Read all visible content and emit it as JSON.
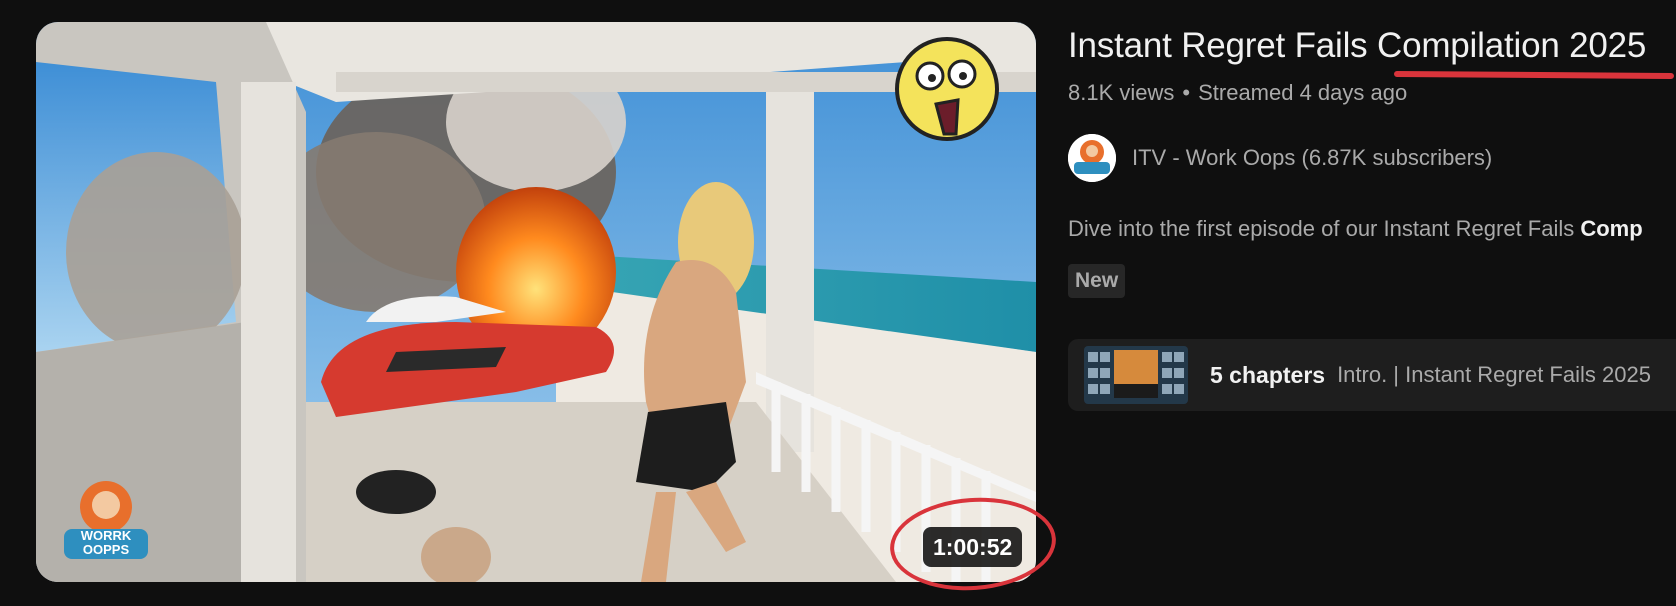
{
  "video": {
    "title": "Instant Regret Fails Compilation 2025",
    "views": "8.1K views",
    "separator": "•",
    "streamed": "Streamed 4 days ago",
    "duration": "1:00:52",
    "thumbnail_icon": "shocked-emoji-icon",
    "thumbnail_logo_text": "WORRK OOPPS"
  },
  "channel": {
    "name": "ITV - Work Oops (6.87K subscribers)",
    "avatar_icon": "channel-avatar-icon"
  },
  "description": {
    "text": "Dive into the first episode of our Instant Regret Fails ",
    "bold": "Comp"
  },
  "badge": {
    "label": "New"
  },
  "chapters": {
    "count_label": "5 chapters",
    "title": "Intro. | Instant Regret Fails 2025"
  },
  "colors": {
    "background": "#0f0f0f",
    "annotation_red": "#d9343b",
    "secondary_text": "#aaaaaa",
    "primary_text": "#f1f1f1"
  }
}
